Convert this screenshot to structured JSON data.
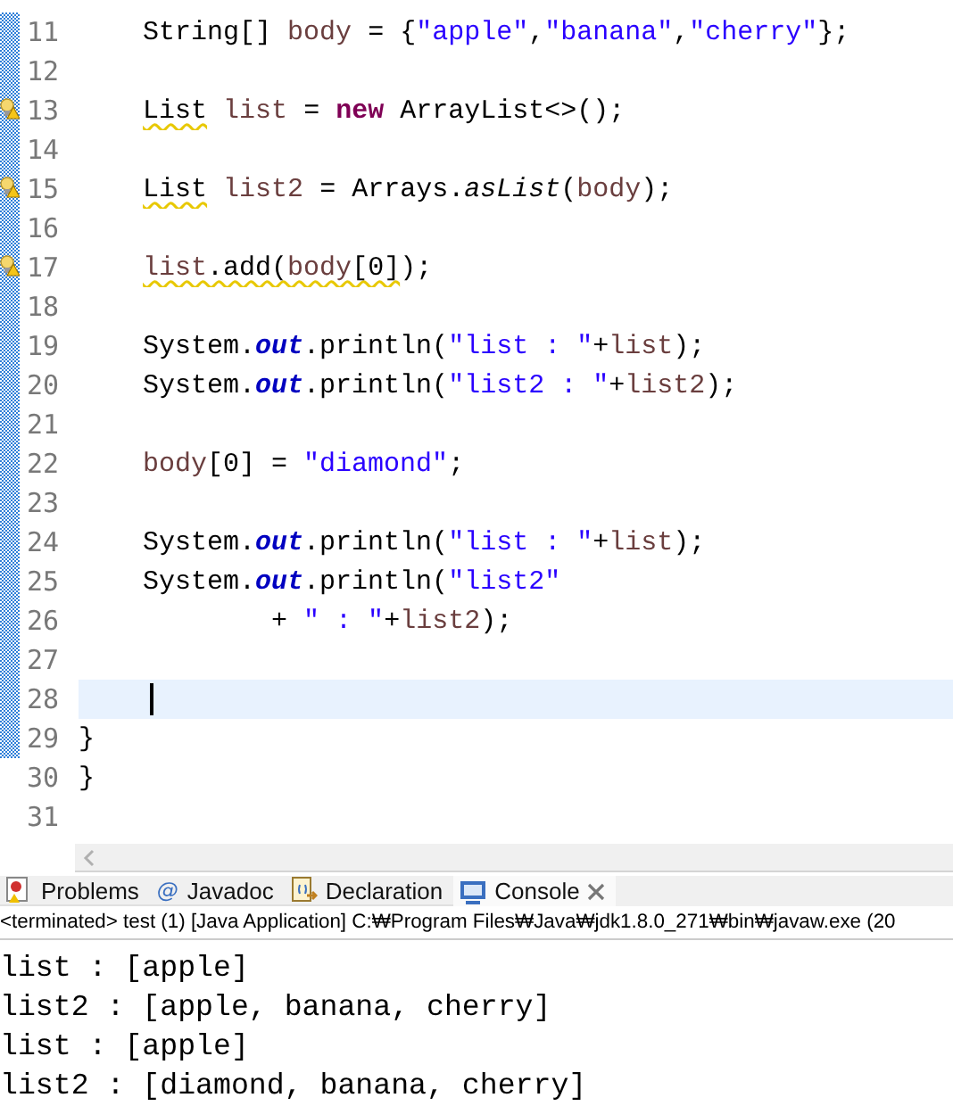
{
  "editor": {
    "lines": [
      {
        "number": "11",
        "changed": true,
        "warning": false,
        "current": false,
        "tokens": [
          {
            "kind": "plain",
            "text": "    String[] "
          },
          {
            "kind": "var",
            "text": "body"
          },
          {
            "kind": "plain",
            "text": " = {"
          },
          {
            "kind": "string",
            "text": "\"apple\""
          },
          {
            "kind": "plain",
            "text": ","
          },
          {
            "kind": "string",
            "text": "\"banana\""
          },
          {
            "kind": "plain",
            "text": ","
          },
          {
            "kind": "string",
            "text": "\"cherry\""
          },
          {
            "kind": "plain",
            "text": "};"
          }
        ]
      },
      {
        "number": "12",
        "changed": true,
        "warning": false,
        "current": false
      },
      {
        "number": "13",
        "changed": true,
        "warning": true,
        "current": false,
        "tokens": [
          {
            "kind": "type",
            "text": "    List",
            "squiggle": true
          },
          {
            "kind": "var",
            "text": " list"
          },
          {
            "kind": "plain",
            "text": " = "
          },
          {
            "kind": "keyword",
            "text": "new"
          },
          {
            "kind": "plain",
            "text": " ArrayList<>();"
          }
        ]
      },
      {
        "number": "14",
        "changed": true,
        "warning": false,
        "current": false
      },
      {
        "number": "15",
        "changed": true,
        "warning": true,
        "current": false,
        "tokens": [
          {
            "kind": "type",
            "text": "    List",
            "squiggle": true
          },
          {
            "kind": "var",
            "text": " list2"
          },
          {
            "kind": "plain",
            "text": " = Arrays."
          },
          {
            "kind": "static",
            "text": "asList"
          },
          {
            "kind": "plain",
            "text": "("
          },
          {
            "kind": "var",
            "text": "body"
          },
          {
            "kind": "plain",
            "text": ");"
          }
        ]
      },
      {
        "number": "16",
        "changed": true,
        "warning": false,
        "current": false
      },
      {
        "number": "17",
        "changed": true,
        "warning": true,
        "current": false,
        "tokens": [
          {
            "kind": "var",
            "text": "    list",
            "squiggle": true
          },
          {
            "kind": "plain",
            "text": ".add(",
            "squiggle": true
          },
          {
            "kind": "var",
            "text": "body",
            "squiggle": true
          },
          {
            "kind": "plain",
            "text": "[0]",
            "squiggle": true
          },
          {
            "kind": "plain",
            "text": ");"
          }
        ]
      },
      {
        "number": "18",
        "changed": true,
        "warning": false,
        "current": false
      },
      {
        "number": "19",
        "changed": true,
        "warning": false,
        "current": false,
        "tokens": [
          {
            "kind": "plain",
            "text": "    System."
          },
          {
            "kind": "field",
            "text": "out"
          },
          {
            "kind": "plain",
            "text": ".println("
          },
          {
            "kind": "string",
            "text": "\"list : \""
          },
          {
            "kind": "plain",
            "text": "+"
          },
          {
            "kind": "var",
            "text": "list"
          },
          {
            "kind": "plain",
            "text": ");"
          }
        ]
      },
      {
        "number": "20",
        "changed": true,
        "warning": false,
        "current": false,
        "tokens": [
          {
            "kind": "plain",
            "text": "    System."
          },
          {
            "kind": "field",
            "text": "out"
          },
          {
            "kind": "plain",
            "text": ".println("
          },
          {
            "kind": "string",
            "text": "\"list2 : \""
          },
          {
            "kind": "plain",
            "text": "+"
          },
          {
            "kind": "var",
            "text": "list2"
          },
          {
            "kind": "plain",
            "text": ");"
          }
        ]
      },
      {
        "number": "21",
        "changed": true,
        "warning": false,
        "current": false
      },
      {
        "number": "22",
        "changed": true,
        "warning": false,
        "current": false,
        "tokens": [
          {
            "kind": "var",
            "text": "    body"
          },
          {
            "kind": "plain",
            "text": "[0] = "
          },
          {
            "kind": "string",
            "text": "\"diamond\""
          },
          {
            "kind": "plain",
            "text": ";"
          }
        ]
      },
      {
        "number": "23",
        "changed": true,
        "warning": false,
        "current": false
      },
      {
        "number": "24",
        "changed": true,
        "warning": false,
        "current": false,
        "tokens": [
          {
            "kind": "plain",
            "text": "    System."
          },
          {
            "kind": "field",
            "text": "out"
          },
          {
            "kind": "plain",
            "text": ".println("
          },
          {
            "kind": "string",
            "text": "\"list : \""
          },
          {
            "kind": "plain",
            "text": "+"
          },
          {
            "kind": "var",
            "text": "list"
          },
          {
            "kind": "plain",
            "text": ");"
          }
        ]
      },
      {
        "number": "25",
        "changed": true,
        "warning": false,
        "current": false,
        "tokens": [
          {
            "kind": "plain",
            "text": "    System."
          },
          {
            "kind": "field",
            "text": "out"
          },
          {
            "kind": "plain",
            "text": ".println("
          },
          {
            "kind": "string",
            "text": "\"list2\""
          }
        ]
      },
      {
        "number": "26",
        "changed": true,
        "warning": false,
        "current": false,
        "tokens": [
          {
            "kind": "plain",
            "text": "            + "
          },
          {
            "kind": "string",
            "text": "\" : \""
          },
          {
            "kind": "plain",
            "text": "+"
          },
          {
            "kind": "var",
            "text": "list2"
          },
          {
            "kind": "plain",
            "text": ");"
          }
        ]
      },
      {
        "number": "27",
        "changed": true,
        "warning": false,
        "current": false
      },
      {
        "number": "28",
        "changed": true,
        "warning": false,
        "current": true
      },
      {
        "number": "29",
        "changed": true,
        "warning": false,
        "current": false,
        "tokens": [
          {
            "kind": "plain",
            "text": "}"
          }
        ]
      },
      {
        "number": "30",
        "changed": false,
        "warning": false,
        "current": false,
        "tokens": [
          {
            "kind": "plain",
            "text": "}"
          }
        ]
      },
      {
        "number": "31",
        "changed": false,
        "warning": false,
        "current": false
      }
    ]
  },
  "tabs": [
    {
      "kind": "problems",
      "label": "Problems",
      "selected": false
    },
    {
      "kind": "javadoc",
      "glyph": "@",
      "label": "Javadoc",
      "selected": false
    },
    {
      "kind": "declaration",
      "label": "Declaration",
      "selected": false
    },
    {
      "kind": "console",
      "label": "Console",
      "selected": true
    }
  ],
  "console": {
    "status": "<terminated> test (1) [Java Application] C:₩Program Files₩Java₩jdk1.8.0_271₩bin₩javaw.exe  (20",
    "output": [
      "list : [apple]",
      "list2 : [apple, banana, cherry]",
      "list : [apple]",
      "list2 : [diamond, banana, cherry]"
    ]
  }
}
